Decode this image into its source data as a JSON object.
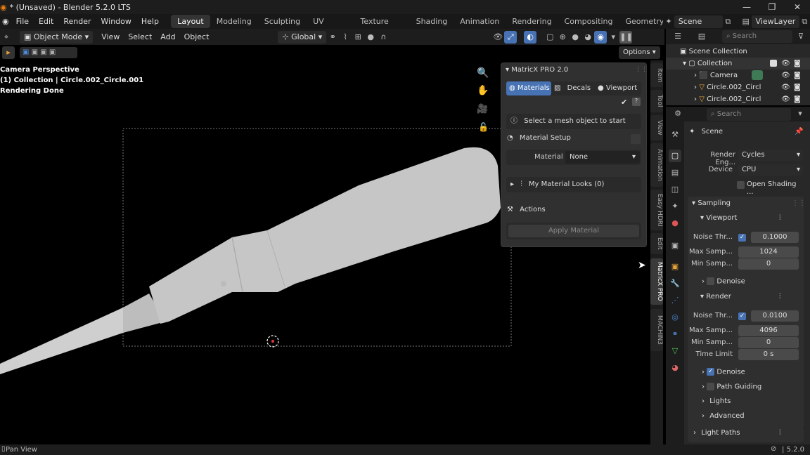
{
  "window": {
    "title": "* (Unsaved) - Blender 5.2.0 LTS"
  },
  "menus": [
    "File",
    "Edit",
    "Render",
    "Window",
    "Help"
  ],
  "workspaces": [
    "Layout",
    "Modeling",
    "Sculpting",
    "UV Editing",
    "Texture Paint",
    "Shading",
    "Animation",
    "Rendering",
    "Compositing",
    "Geometry Node"
  ],
  "active_workspace": "Layout",
  "scene_field": "Scene",
  "viewlayer_field": "ViewLayer",
  "header": {
    "mode": "Object Mode",
    "menu": [
      "View",
      "Select",
      "Add",
      "Object"
    ],
    "orientation": "Global",
    "options": "Options"
  },
  "viewport_overlay": [
    "Camera Perspective",
    "(1) Collection | Circle.002_Circle.001",
    "Rendering Done"
  ],
  "matrix_panel": {
    "title": "MatricX PRO 2.0",
    "tabs": [
      "Materials",
      "Decals",
      "Viewport"
    ],
    "info": "Select a mesh object to start",
    "material_setup": "Material Setup",
    "material_label": "Material",
    "material_value": "None",
    "looks": "My Material Looks (0)",
    "actions": "Actions",
    "apply": "Apply Material"
  },
  "side_tabs": [
    "Item",
    "Tool",
    "View",
    "Animation",
    "Easy HDRI",
    "Edit",
    "MatricX PRO",
    "MACHIN3"
  ],
  "outliner": {
    "search_placeholder": "Search",
    "root": "Scene Collection",
    "items": [
      "Collection",
      "Camera",
      "Circle.002_Circl",
      "Circle.002_Circl"
    ]
  },
  "properties": {
    "search_placeholder": "Search",
    "context": "Scene",
    "render_engine_label": "Render Eng...",
    "render_engine": "Cycles",
    "device_label": "Device",
    "device": "CPU",
    "open_shading": "Open Shading ...",
    "sampling": "Sampling",
    "viewport": "Viewport",
    "vp_noise_label": "Noise Thr...",
    "vp_noise": "0.1000",
    "vp_max_label": "Max Samp...",
    "vp_max": "1024",
    "vp_min_label": "Min Samp...",
    "vp_min": "0",
    "denoise": "Denoise",
    "render": "Render",
    "r_noise_label": "Noise Thr...",
    "r_noise": "0.0100",
    "r_max_label": "Max Samp...",
    "r_max": "4096",
    "r_min_label": "Min Samp...",
    "r_min": "0",
    "time_label": "Time Limit",
    "time": "0 s",
    "r_denoise": "Denoise",
    "path_guiding": "Path Guiding",
    "lights": "Lights",
    "advanced": "Advanced",
    "light_paths": "Light Paths"
  },
  "status": {
    "left": "Pan View",
    "version": "5.2.0"
  },
  "colors": {
    "accent": "#4772b3",
    "bg": "#000000",
    "panel": "#303030"
  }
}
